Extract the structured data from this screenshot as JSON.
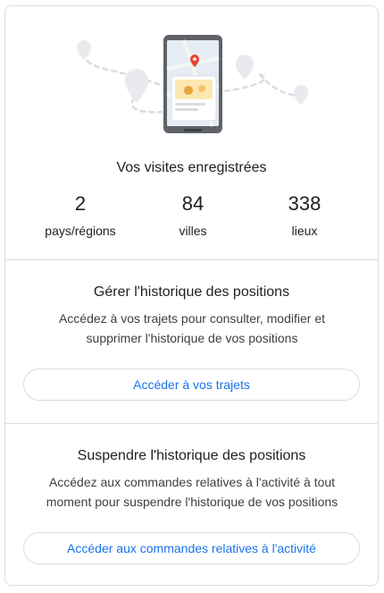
{
  "visits": {
    "title": "Vos visites enregistrées",
    "stats": [
      {
        "value": "2",
        "label": "pays/régions"
      },
      {
        "value": "84",
        "label": "villes"
      },
      {
        "value": "338",
        "label": "lieux"
      }
    ]
  },
  "manage": {
    "title": "Gérer l'historique des positions",
    "description": "Accédez à vos trajets pour consulter, modifier et supprimer l'historique de vos positions",
    "button_label": "Accéder à vos trajets"
  },
  "pause": {
    "title": "Suspendre l'historique des positions",
    "description": "Accédez aux commandes relatives à l'activité à tout moment pour suspendre l'historique de vos positions",
    "button_label": "Accéder aux commandes relatives à l'activité"
  },
  "colors": {
    "accent": "#1a73e8",
    "pin_red": "#ea4335",
    "border": "#dadce0"
  }
}
